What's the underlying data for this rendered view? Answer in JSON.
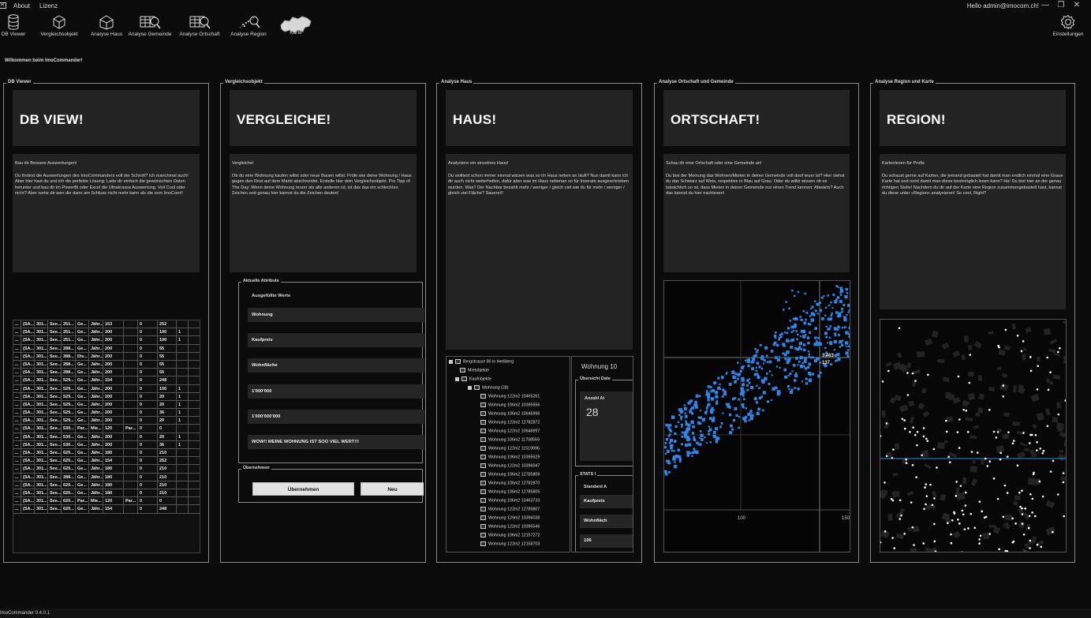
{
  "app": {
    "logo": "R",
    "menu": [
      "About",
      "Lizenz"
    ],
    "greeting": "Hello admin@imocom.ch!",
    "window_controls": [
      "—",
      "❐",
      "✕"
    ]
  },
  "toolbar": {
    "items": [
      {
        "label": "DB Viewer",
        "icon": "database-icon"
      },
      {
        "label": "Vergleichsobjekt",
        "icon": "cube-icon"
      },
      {
        "label": "Analyse Haus",
        "icon": "house-cube-icon"
      },
      {
        "label": "Analyse Gemeinde",
        "icon": "grid-magnifier-icon"
      },
      {
        "label": "Analyse Ortschaft",
        "icon": "grid-magnifier-icon"
      },
      {
        "label": "Analyse Region",
        "icon": "scatter-magnifier-icon"
      },
      {
        "label": "Karte",
        "icon": "switzerland-map-icon"
      }
    ],
    "settings_label": "Einstellungen"
  },
  "welcome": "Wilkommen beim ImoCommander!",
  "columns": {
    "db": {
      "legend": "DB Viewer",
      "banner": "DB VIEW!",
      "lead": "Bau dir Bessere Auswertungen!",
      "body": "Du findest die Auswertungen des ImoCommanders voll der Schrott? Ich manchmal auch! Aber hier hast du und ich die perfekte Lösung: Lade dir einfach die gewünschten Daten herunter und bau dir im PowerBi oder Excel die Ultrakrasse Auswertung. Voll Cool oder nicht? Aber wehe dir wen die dann am Schluss nicht mehr kann als die vom ImoCom!!",
      "rows": [
        [
          "...",
          "(SA...",
          "301...",
          "See...",
          "251...",
          "Ge...",
          "Jähr...",
          "153",
          "",
          "0",
          "252",
          ""
        ],
        [
          "...",
          "(SA...",
          "301...",
          "See...",
          "251...",
          "Ge...",
          "Jähr...",
          "200",
          "",
          "0",
          "100",
          "1"
        ],
        [
          "...",
          "(SA...",
          "301...",
          "See...",
          "251...",
          "Ge...",
          "Jähr...",
          "200",
          "",
          "0",
          "100",
          "1"
        ],
        [
          "...",
          "(SA...",
          "301...",
          "See...",
          "288...",
          "Ge...",
          "Jähr...",
          "200",
          "",
          "0",
          "55",
          ""
        ],
        [
          "...",
          "(SA...",
          "301...",
          "See...",
          "288...",
          "Div...",
          "Jähr...",
          "200",
          "",
          "0",
          "55",
          ""
        ],
        [
          "...",
          "(SA...",
          "301...",
          "See...",
          "288...",
          "Ge...",
          "Jähr...",
          "200",
          "",
          "0",
          "55",
          ""
        ],
        [
          "...",
          "(SA...",
          "301...",
          "See...",
          "288...",
          "Ge...",
          "Jähr...",
          "200",
          "",
          "0",
          "55",
          ""
        ],
        [
          "...",
          "(SA...",
          "301...",
          "See...",
          "529...",
          "Ge...",
          "Jähr...",
          "154",
          "",
          "0",
          "248",
          ""
        ],
        [
          "...",
          "(SA...",
          "301...",
          "See...",
          "529...",
          "Ge...",
          "Jähr...",
          "200",
          "",
          "0",
          "100",
          "1"
        ],
        [
          "...",
          "(SA...",
          "301...",
          "See...",
          "529...",
          "Ge...",
          "Jähr...",
          "200",
          "",
          "0",
          "20",
          "1"
        ],
        [
          "...",
          "(SA...",
          "301...",
          "See...",
          "529...",
          "Ge...",
          "Jähr...",
          "200",
          "",
          "0",
          "20",
          "1"
        ],
        [
          "...",
          "(SA...",
          "301...",
          "See...",
          "529...",
          "Ge...",
          "Jähr...",
          "200",
          "",
          "0",
          "36",
          "1"
        ],
        [
          "...",
          "(SA...",
          "301...",
          "See...",
          "529...",
          "Ge...",
          "Jähr...",
          "200",
          "",
          "0",
          "20",
          "1"
        ],
        [
          "...",
          "(SA...",
          "301...",
          "See...",
          "530...",
          "Par...",
          "Mie...",
          "120",
          "Par...",
          "0",
          "0",
          ""
        ],
        [
          "...",
          "(SA...",
          "301...",
          "See...",
          "530...",
          "Ge...",
          "Jähr...",
          "200",
          "",
          "0",
          "20",
          "1"
        ],
        [
          "...",
          "(SA...",
          "301...",
          "See...",
          "530...",
          "Ge...",
          "Jähr...",
          "200",
          "",
          "0",
          "36",
          "1"
        ],
        [
          "...",
          "(SA...",
          "301...",
          "See...",
          "620...",
          "Ge...",
          "Jähr...",
          "180",
          "",
          "0",
          "210",
          ""
        ],
        [
          "...",
          "(SA...",
          "301...",
          "See...",
          "620...",
          "Ge...",
          "Jähr...",
          "154",
          "",
          "0",
          "252",
          ""
        ],
        [
          "...",
          "(SA...",
          "301...",
          "See...",
          "620...",
          "Ge...",
          "Jähr...",
          "180",
          "",
          "0",
          "210",
          ""
        ],
        [
          "...",
          "(SA...",
          "301...",
          "See...",
          "288...",
          "Ge...",
          "Jähr...",
          "180",
          "",
          "0",
          "210",
          ""
        ],
        [
          "...",
          "(SA...",
          "301...",
          "See...",
          "620...",
          "Ge...",
          "Jähr...",
          "180",
          "",
          "0",
          "210",
          ""
        ],
        [
          "...",
          "(SA...",
          "301...",
          "See...",
          "620...",
          "Ge...",
          "Jähr...",
          "180",
          "",
          "0",
          "210",
          ""
        ],
        [
          "...",
          "(SA...",
          "301...",
          "See...",
          "620...",
          "Par...",
          "Mie...",
          "120",
          "Par...",
          "0",
          "0",
          ""
        ],
        [
          "...",
          "(SA...",
          "301...",
          "See...",
          "620...",
          "Ge...",
          "Jähr...",
          "154",
          "",
          "0",
          "248",
          ""
        ]
      ]
    },
    "vergleich": {
      "legend": "Vergleichsobjekt",
      "banner": "VERGLEICHE!",
      "lead": "Vergleiche!",
      "body": "Ob du eine Wohnung kaufen willst oder neue Bauen willst: Prüfe wie deine Wohnung / Haus gegen den Rest auf dem Markt abschneidet. Erstelle hier dein Vergleichsobjekt. Pro Tipp of The Day: Wenn deine Wohnung teurer als alle anderen ist, ist das das ein schlechtes Zeichen und genau hier kannst du die Zeichen deuten!",
      "attr_legend": "Aktuelle Attribute",
      "attr_sub": "Ausgefüllte Werte",
      "fields": [
        "Wohnung",
        "Kaufpreis",
        "Wohnfläche",
        "1'000'000",
        "1'000'000'000",
        "WOW!! MEINE WOHNUNG IST SOO VIEL WERT!!!"
      ],
      "uber_legend": "Übernehmen",
      "btn_apply": "Übernehmen",
      "btn_new": "Neu"
    },
    "haus": {
      "legend": "Analyse Haus",
      "banner": "HAUS!",
      "lead": "Analysiere ein einzelnes Haus!",
      "body": "Du wolltest schon immer einmal wissen was so im Haus neben an läuft?  Nun damit kann ich dir auch nicht weiterhelfen, dafür aber was im Haus nebenan so für Inserate ausgeschrieben wurden. Was? Der Nachbar bezahlt mehr / weniger / gleich viel wie du für mehr / weniger / gleich viel Fläche? Sauerei!!",
      "tree_root": "Bergstrasse 80 in Herliberg",
      "tree_miet": "Mietobjekte",
      "tree_kauf": "Kaufobjekte",
      "tree_wohnung": "Wohnung (28)",
      "tree_items": [
        "Wohnung 122m2 10465261",
        "Wohnung 106m2 10395556",
        "Wohnung 106m2 10646996",
        "Wohnung 122m2 12782872",
        "Wohnung 122m2 10646997",
        "Wohnung 106m2 11708559",
        "Wohnung 122m2 11519996",
        "Wohnung 106m2 10395529",
        "Wohnung 122m2 10396047",
        "Wohnung 106m2 12785809",
        "Wohnung 106m2 12782870",
        "Wohnung 106m2 12785805",
        "Wohnung 106m2 10463733",
        "Wohnung 122m2 12785807",
        "Wohnung 129m2 10396038",
        "Wohnung 122m2 10395546",
        "Wohnung 106m2 12157272",
        "Wohnung 122m2 12158703"
      ],
      "detail_title": "Wohnung 10",
      "detail_overview": "Übersicht Date",
      "detail_count_label": "Anzahl At",
      "detail_count": "28",
      "stats_legend": "STATS I",
      "stats_standard": "Standard A",
      "stats_kaufpreis": "Kaufpreis",
      "stats_wohnflache": "Wohnfläch",
      "stats_value": "106"
    },
    "ort": {
      "legend": "Analyse Ortschaft und Gemeinde",
      "banner": "ORTSCHAFT!",
      "body": "Du bist der Meinung das Wohnen/Mieten in deiner Gemeinde voll doof teuer ist? Hier siehst du das Schwarz auf Weis, respektive in Blau auf Grau. Oder du willst wissen ob es tatsächlich so ist, dass Mieten in deiner Gemeinde nur einen Trend kennen: Abwärts? Auch das kannst du hier nachlesen!",
      "lead": "Schau dir eine Ortschaft oder eine Gemeinde an!",
      "crosshair_y": "3'463",
      "crosshair_x": "137",
      "tick_100": "100",
      "tick_150": "150"
    },
    "region": {
      "legend": "Analyse Region und Karte",
      "banner": "REGION!",
      "lead": "Kartenlesen für Profis",
      "body": "Du schaust gerne auf Karten, die jemand gebastelt hat damit man endlich einmal eine Graue Karte hat und nicht damit man diese bestmöglich lesen kann? Ha! Du bist hier an der genau richtigen Stelle! Nachdem du dir auf der Karte eine Region zusammengebastelt hast, kannst du diese unter «Region» analysieren! So cool, Right?"
    }
  },
  "status": "ImoCommander 0.4.0.1",
  "colors": {
    "accent": "#2f86e8",
    "panel": "#232323",
    "bg": "#0b0b0b"
  }
}
